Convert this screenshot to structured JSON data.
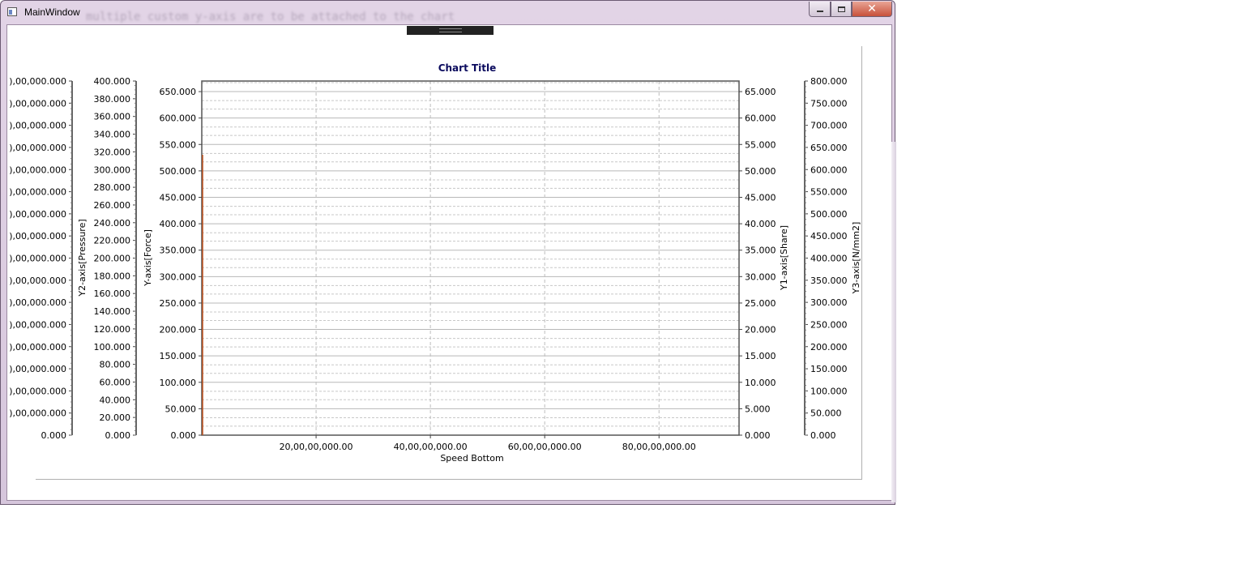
{
  "window": {
    "title": "MainWindow",
    "ghost_text": "multiple custom y-axis are to be attached to the chart",
    "close_label": "✕"
  },
  "chart_data": {
    "type": "line",
    "title": "Chart Title",
    "xlabel": "Speed Bottom",
    "xlim": [
      0,
      9400000000
    ],
    "x_ticks": [
      2000000000,
      4000000000,
      6000000000,
      8000000000
    ],
    "x_tick_labels": [
      "20,00,00,000.00",
      "40,00,00,000.00",
      "60,00,00,000.00",
      "80,00,00,000.00"
    ],
    "grid": true,
    "axes": [
      {
        "id": "y4",
        "label": "",
        "ylim": [
          0,
          160000000
        ],
        "tick_labels": [
          "0.000",
          "),00,000.000",
          "),00,000.000",
          "),00,000.000",
          "),00,000.000",
          "),00,000.000",
          "),00,000.000",
          "),00,000.000",
          "),00,000.000",
          "),00,000.000",
          "),00,000.000",
          "),00,000.000",
          "),00,000.000",
          "),00,000.000",
          "),00,000.000",
          "),00,000.000",
          "),00,000.000"
        ]
      },
      {
        "id": "y2",
        "label": "Y2-axis[Pressure]",
        "ylim": [
          0,
          400
        ],
        "tick_labels": [
          "0.000",
          "20.000",
          "40.000",
          "60.000",
          "80.000",
          "100.000",
          "120.000",
          "140.000",
          "160.000",
          "180.000",
          "200.000",
          "220.000",
          "240.000",
          "260.000",
          "280.000",
          "300.000",
          "320.000",
          "340.000",
          "360.000",
          "380.000",
          "400.000"
        ]
      },
      {
        "id": "y",
        "label": "Y-axis[Force]",
        "ylim": [
          0,
          670
        ],
        "tick_labels": [
          "0.000",
          "50.000",
          "100.000",
          "150.000",
          "200.000",
          "250.000",
          "300.000",
          "350.000",
          "400.000",
          "450.000",
          "500.000",
          "550.000",
          "600.000",
          "650.000"
        ]
      },
      {
        "id": "y1",
        "label": "Y1-axis[Share]",
        "ylim": [
          0,
          67
        ],
        "tick_labels": [
          "0.000",
          "5.000",
          "10.000",
          "15.000",
          "20.000",
          "25.000",
          "30.000",
          "35.000",
          "40.000",
          "45.000",
          "50.000",
          "55.000",
          "60.000",
          "65.000"
        ]
      },
      {
        "id": "y3",
        "label": "Y3-axis[N/mm2]",
        "ylim": [
          0,
          800
        ],
        "tick_labels": [
          "0.000",
          "50.000",
          "100.000",
          "150.000",
          "200.000",
          "250.000",
          "300.000",
          "350.000",
          "400.000",
          "450.000",
          "500.000",
          "550.000",
          "600.000",
          "650.000",
          "700.000",
          "750.000",
          "800.000"
        ]
      }
    ],
    "series": [
      {
        "values": [],
        "color": "#c0501d"
      }
    ]
  }
}
